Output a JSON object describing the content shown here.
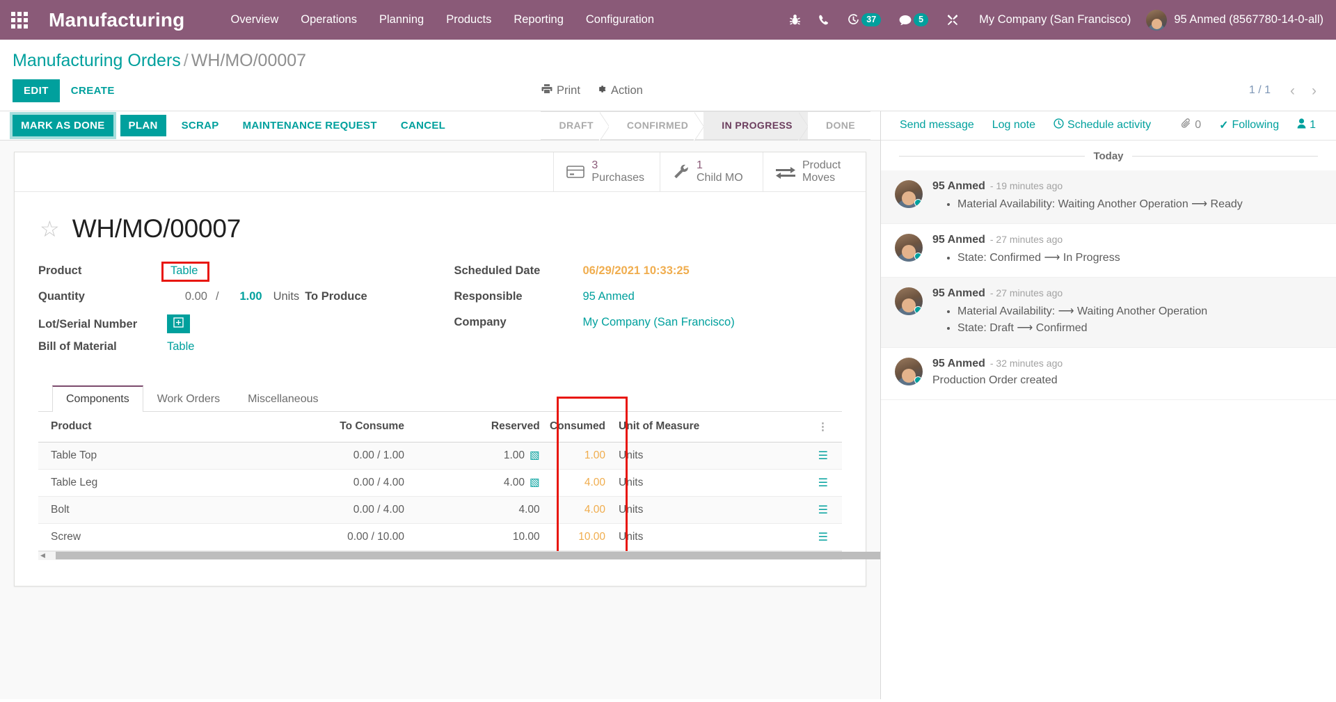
{
  "navbar": {
    "apps_icon": "apps-grid-icon",
    "brand": "Manufacturing",
    "menu": [
      {
        "label": "Overview"
      },
      {
        "label": "Operations"
      },
      {
        "label": "Planning"
      },
      {
        "label": "Products"
      },
      {
        "label": "Reporting"
      },
      {
        "label": "Configuration"
      }
    ],
    "icons": [
      {
        "name": "bug-icon",
        "badge": null
      },
      {
        "name": "phone-icon",
        "badge": null
      },
      {
        "name": "activity-clock-icon",
        "badge": "37"
      },
      {
        "name": "messages-icon",
        "badge": "5"
      },
      {
        "name": "tools-icon",
        "badge": null
      }
    ],
    "company": "My Company (San Francisco)",
    "user": "95 Anmed (8567780-14-0-all)",
    "accent": "#8a5a78"
  },
  "control_panel": {
    "breadcrumb_root": "Manufacturing Orders",
    "breadcrumb_sep": "/",
    "breadcrumb_current": "WH/MO/00007",
    "edit_label": "EDIT",
    "create_label": "CREATE",
    "print_label": "Print",
    "action_label": "Action",
    "pager_value": "1 / 1",
    "pager_prev": "‹",
    "pager_next": "›"
  },
  "statusbar": {
    "buttons": [
      {
        "label": "MARK AS DONE",
        "style": "focused"
      },
      {
        "label": "PLAN",
        "style": "primary"
      },
      {
        "label": "SCRAP",
        "style": "link"
      },
      {
        "label": "MAINTENANCE REQUEST",
        "style": "link"
      },
      {
        "label": "CANCEL",
        "style": "link"
      }
    ],
    "stages": [
      {
        "label": "DRAFT",
        "active": false
      },
      {
        "label": "CONFIRMED",
        "active": false
      },
      {
        "label": "IN PROGRESS",
        "active": true
      },
      {
        "label": "DONE",
        "active": false
      }
    ]
  },
  "chatter": {
    "send_message": "Send message",
    "log_note": "Log note",
    "schedule_activity": "Schedule activity",
    "attachment_count": "0",
    "following_label": "Following",
    "follower_count": "1",
    "day_label": "Today",
    "messages": [
      {
        "author": "95 Anmed",
        "time": "- 19 minutes ago",
        "items": [
          "Material Availability: Waiting Another Operation ⟶ Ready"
        ]
      },
      {
        "author": "95 Anmed",
        "time": "- 27 minutes ago",
        "items": [
          "State: Confirmed ⟶ In Progress"
        ]
      },
      {
        "author": "95 Anmed",
        "time": "- 27 minutes ago",
        "items": [
          "Material Availability: ⟶ Waiting Another Operation",
          "State: Draft ⟶ Confirmed"
        ]
      },
      {
        "author": "95 Anmed",
        "time": "- 32 minutes ago",
        "plain": "Production Order created"
      }
    ]
  },
  "form": {
    "stat_buttons": [
      {
        "value": "3",
        "label": "Purchases",
        "icon": "card-icon"
      },
      {
        "value": "1",
        "label": "Child MO",
        "icon": "wrench-icon"
      },
      {
        "value": "",
        "label_line1": "Product",
        "label_line2": "Moves",
        "icon": "exchange-arrows-icon"
      }
    ],
    "title": "WH/MO/00007",
    "left_fields": {
      "product_label": "Product",
      "product_value": "Table",
      "quantity_label": "Quantity",
      "quantity_done": "0.00",
      "quantity_sep": "/",
      "quantity_todo": "1.00",
      "quantity_uom": "Units",
      "quantity_state": "To Produce",
      "lot_label": "Lot/Serial Number",
      "lot_button_icon": "plus-box-icon",
      "bom_label": "Bill of Material",
      "bom_value": "Table"
    },
    "right_fields": {
      "scheduled_label": "Scheduled Date",
      "scheduled_value": "06/29/2021 10:33:25",
      "responsible_label": "Responsible",
      "responsible_value": "95 Anmed",
      "company_label": "Company",
      "company_value": "My Company (San Francisco)"
    },
    "tabs": [
      {
        "label": "Components",
        "active": true
      },
      {
        "label": "Work Orders",
        "active": false
      },
      {
        "label": "Miscellaneous",
        "active": false
      }
    ],
    "table": {
      "columns": [
        "Product",
        "To Consume",
        "Reserved",
        "Consumed",
        "Unit of Measure"
      ],
      "rows": [
        {
          "product": "Table Top",
          "to_consume": "0.00 / 1.00",
          "reserved": "1.00",
          "reserved_icon": true,
          "consumed": "1.00",
          "uom": "Units"
        },
        {
          "product": "Table Leg",
          "to_consume": "0.00 / 4.00",
          "reserved": "4.00",
          "reserved_icon": true,
          "consumed": "4.00",
          "uom": "Units"
        },
        {
          "product": "Bolt",
          "to_consume": "0.00 / 4.00",
          "reserved": "4.00",
          "reserved_icon": false,
          "consumed": "4.00",
          "uom": "Units"
        },
        {
          "product": "Screw",
          "to_consume": "0.00 / 10.00",
          "reserved": "10.00",
          "reserved_icon": false,
          "consumed": "10.00",
          "uom": "Units"
        }
      ]
    }
  },
  "colors": {
    "brand_purple": "#8a5a78",
    "teal": "#00a09d",
    "warning_orange": "#f0ad4e",
    "highlight_red": "#e8170f"
  }
}
